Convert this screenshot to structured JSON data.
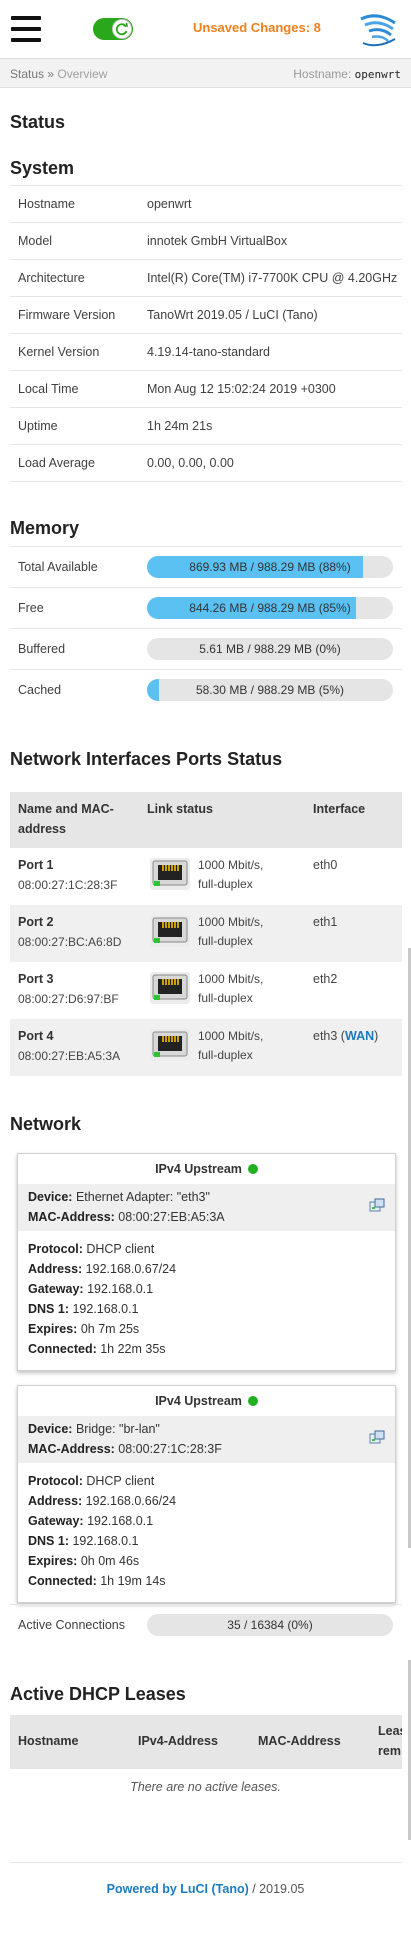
{
  "header": {
    "unsaved": "Unsaved Changes: 8",
    "accent": "#f0801c"
  },
  "breadcrumb": {
    "root": "Status",
    "sep": "»",
    "current": "Overview",
    "hostname_label": "Hostname:",
    "hostname": "openwrt"
  },
  "status": {
    "title": "Status"
  },
  "system": {
    "title": "System",
    "rows": [
      {
        "label": "Hostname",
        "value": "openwrt"
      },
      {
        "label": "Model",
        "value": "innotek GmbH VirtualBox"
      },
      {
        "label": "Architecture",
        "value": "Intel(R) Core(TM) i7-7700K CPU @ 4.20GHz"
      },
      {
        "label": "Firmware Version",
        "value": "TanoWrt 2019.05 / LuCI (Tano)"
      },
      {
        "label": "Kernel Version",
        "value": "4.19.14-tano-standard"
      },
      {
        "label": "Local Time",
        "value": "Mon Aug 12 15:02:24 2019 +0300"
      },
      {
        "label": "Uptime",
        "value": "1h 24m 21s"
      },
      {
        "label": "Load Average",
        "value": "0.00, 0.00, 0.00"
      }
    ]
  },
  "memory": {
    "title": "Memory",
    "rows": [
      {
        "label": "Total Available",
        "text": "869.93 MB / 988.29 MB (88%)",
        "percent": 88
      },
      {
        "label": "Free",
        "text": "844.26 MB / 988.29 MB (85%)",
        "percent": 85
      },
      {
        "label": "Buffered",
        "text": "5.61 MB / 988.29 MB (0%)",
        "percent": 0
      },
      {
        "label": "Cached",
        "text": "58.30 MB / 988.29 MB (5%)",
        "percent": 5
      }
    ]
  },
  "ports": {
    "title": "Network Interfaces Ports Status",
    "headers": {
      "name1": "Name and MAC-",
      "name2": "address",
      "link": "Link status",
      "iface": "Interface"
    },
    "rows": [
      {
        "name": "Port 1",
        "mac": "08:00:27:1C:28:3F",
        "speed": "1000 Mbit/s,",
        "duplex": "full-duplex",
        "iface": "eth0",
        "wan": ""
      },
      {
        "name": "Port 2",
        "mac": "08:00:27:BC:A6:8D",
        "speed": "1000 Mbit/s,",
        "duplex": "full-duplex",
        "iface": "eth1",
        "wan": ""
      },
      {
        "name": "Port 3",
        "mac": "08:00:27:D6:97:BF",
        "speed": "1000 Mbit/s,",
        "duplex": "full-duplex",
        "iface": "eth2",
        "wan": ""
      },
      {
        "name": "Port 4",
        "mac": "08:00:27:EB:A5:3A",
        "speed": "1000 Mbit/s,",
        "duplex": "full-duplex",
        "iface": "eth3 (",
        "wan": "WAN",
        "close": ")"
      }
    ]
  },
  "network": {
    "title": "Network",
    "cards": [
      {
        "title": "IPv4 Upstream",
        "device_label": "Device:",
        "device": " Ethernet Adapter: \"eth3\"",
        "mac_label": "MAC-Address:",
        "mac": " 08:00:27:EB:A5:3A",
        "protocol_label": "Protocol:",
        "protocol": " DHCP client",
        "address_label": "Address:",
        "address": " 192.168.0.67/24",
        "gateway_label": "Gateway:",
        "gateway": " 192.168.0.1",
        "dns_label": "DNS 1:",
        "dns": " 192.168.0.1",
        "expires_label": "Expires:",
        "expires": " 0h 7m 25s",
        "connected_label": "Connected:",
        "connected": " 1h 22m 35s"
      },
      {
        "title": "IPv4 Upstream",
        "device_label": "Device:",
        "device": " Bridge: \"br-lan\"",
        "mac_label": "MAC-Address:",
        "mac": " 08:00:27:1C:28:3F",
        "protocol_label": "Protocol:",
        "protocol": " DHCP client",
        "address_label": "Address:",
        "address": " 192.168.0.66/24",
        "gateway_label": "Gateway:",
        "gateway": " 192.168.0.1",
        "dns_label": "DNS 1:",
        "dns": " 192.168.0.1",
        "expires_label": "Expires:",
        "expires": " 0h 0m 46s",
        "connected_label": "Connected:",
        "connected": " 1h 19m 14s"
      }
    ],
    "active_label": "Active Connections",
    "active_text": "35 / 16384 (0%)",
    "active_percent": 0
  },
  "dhcp": {
    "title": "Active DHCP Leases",
    "headers": {
      "hostname": "Hostname",
      "ipv4": "IPv4-Address",
      "mac": "MAC-Address",
      "lease1": "Leas",
      "lease2": "rem"
    },
    "empty": "There are no active leases."
  },
  "footer": {
    "link": "Powered by LuCI (Tano)",
    "rest": " / 2019.05"
  }
}
